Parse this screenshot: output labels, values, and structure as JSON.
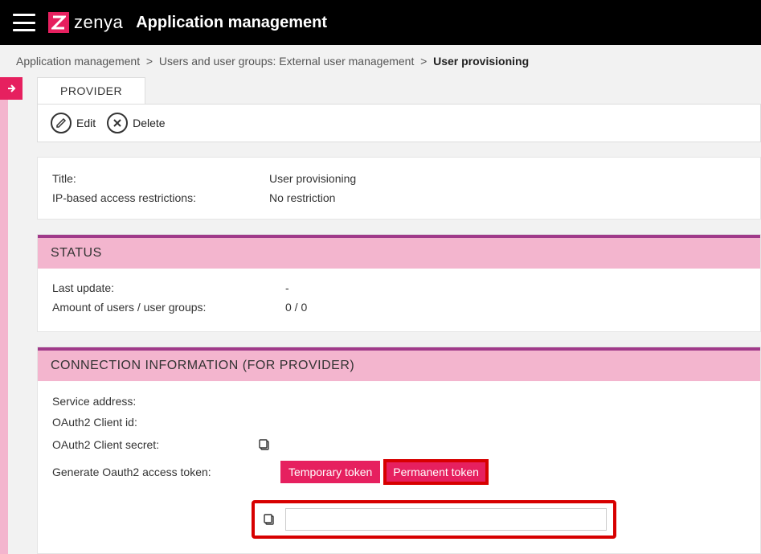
{
  "header": {
    "brand": "zenya",
    "title": "Application management"
  },
  "breadcrumb": {
    "part1": "Application management",
    "part2": "Users and user groups: External user management",
    "current": "User provisioning",
    "sep": ">"
  },
  "tabs": {
    "provider": "PROVIDER"
  },
  "actions": {
    "edit": "Edit",
    "delete": "Delete"
  },
  "summary": {
    "title_label": "Title:",
    "title_value": "User provisioning",
    "ip_label": "IP-based access restrictions:",
    "ip_value": "No restriction"
  },
  "status": {
    "heading": "STATUS",
    "last_update_label": "Last update:",
    "last_update_value": "-",
    "amount_label": "Amount of users / user groups:",
    "amount_value": "0 / 0"
  },
  "connection": {
    "heading": "CONNECTION INFORMATION (FOR PROVIDER)",
    "service_label": "Service address:",
    "client_id_label": "OAuth2 Client id:",
    "client_secret_label": "OAuth2 Client secret:",
    "generate_label": "Generate Oauth2 access token:",
    "temp_token": "Temporary token",
    "perm_token": "Permanent token",
    "token_value": ""
  }
}
